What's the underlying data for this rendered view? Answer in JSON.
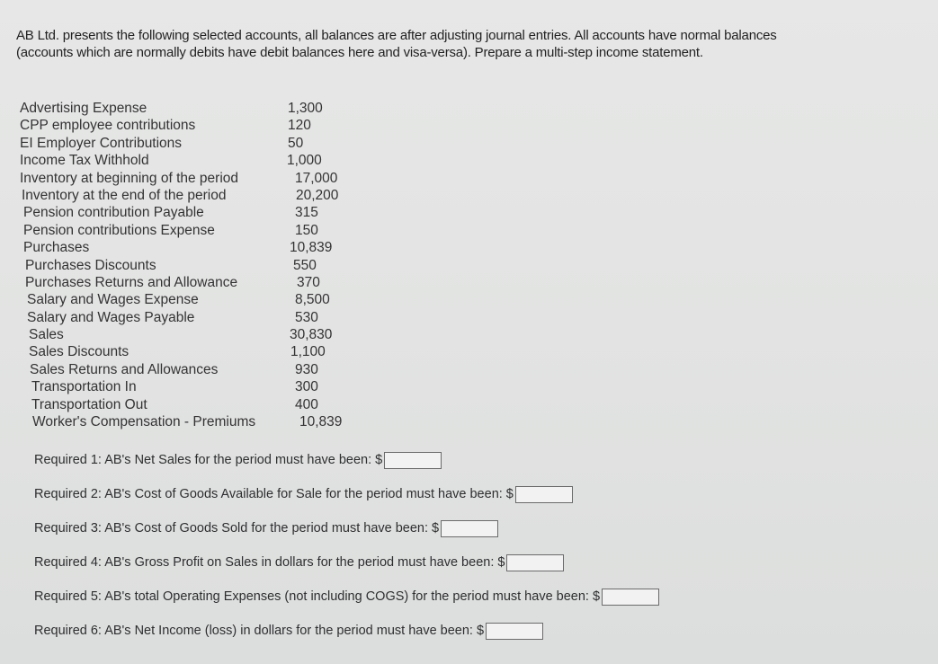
{
  "intro": {
    "line1": "AB Ltd. presents the following selected accounts, all balances are after adjusting journal entries. All accounts have normal balances",
    "line2": "(accounts which are normally debits have debit balances here and visa-versa). Prepare a multi-step income statement."
  },
  "accounts": [
    {
      "name": "Advertising Expense",
      "value": "1,300"
    },
    {
      "name": "CPP employee contributions",
      "value": "120"
    },
    {
      "name": "EI Employer Contributions",
      "value": "50"
    },
    {
      "name": "Income Tax Withhold",
      "value": "1,000"
    },
    {
      "name": "Inventory at beginning of the period",
      "value": "17,000"
    },
    {
      "name": "Inventory at the end of the period",
      "value": "20,200"
    },
    {
      "name": "Pension contribution Payable",
      "value": "315"
    },
    {
      "name": "Pension contributions Expense",
      "value": "150"
    },
    {
      "name": "Purchases",
      "value": "10,839"
    },
    {
      "name": "Purchases Discounts",
      "value": "550"
    },
    {
      "name": "Purchases Returns and Allowance",
      "value": "370"
    },
    {
      "name": "Salary and Wages Expense",
      "value": "8,500"
    },
    {
      "name": "Salary and Wages Payable",
      "value": "530"
    },
    {
      "name": "Sales",
      "value": "30,830"
    },
    {
      "name": "Sales Discounts",
      "value": "1,100"
    },
    {
      "name": "Sales Returns and Allowances",
      "value": "930"
    },
    {
      "name": "Transportation In",
      "value": "300"
    },
    {
      "name": "Transportation Out",
      "value": "400"
    },
    {
      "name": "Worker's Compensation - Premiums",
      "value": "10,839"
    }
  ],
  "required": [
    {
      "label": "Required 1: AB's Net Sales for the period must have been: $",
      "value": ""
    },
    {
      "label": "Required 2: AB's Cost of Goods Available for Sale for the period must have been: $",
      "value": ""
    },
    {
      "label": "Required 3: AB's Cost of Goods Sold for the period must have been: $",
      "value": ""
    },
    {
      "label": "Required 4: AB's Gross Profit on Sales in dollars for the period must have been: $",
      "value": ""
    },
    {
      "label": "Required 5: AB's total Operating Expenses (not including COGS) for the period must have been: $",
      "value": ""
    },
    {
      "label": "Required 6: AB's Net Income (loss) in dollars for the period must have been: $",
      "value": ""
    }
  ]
}
